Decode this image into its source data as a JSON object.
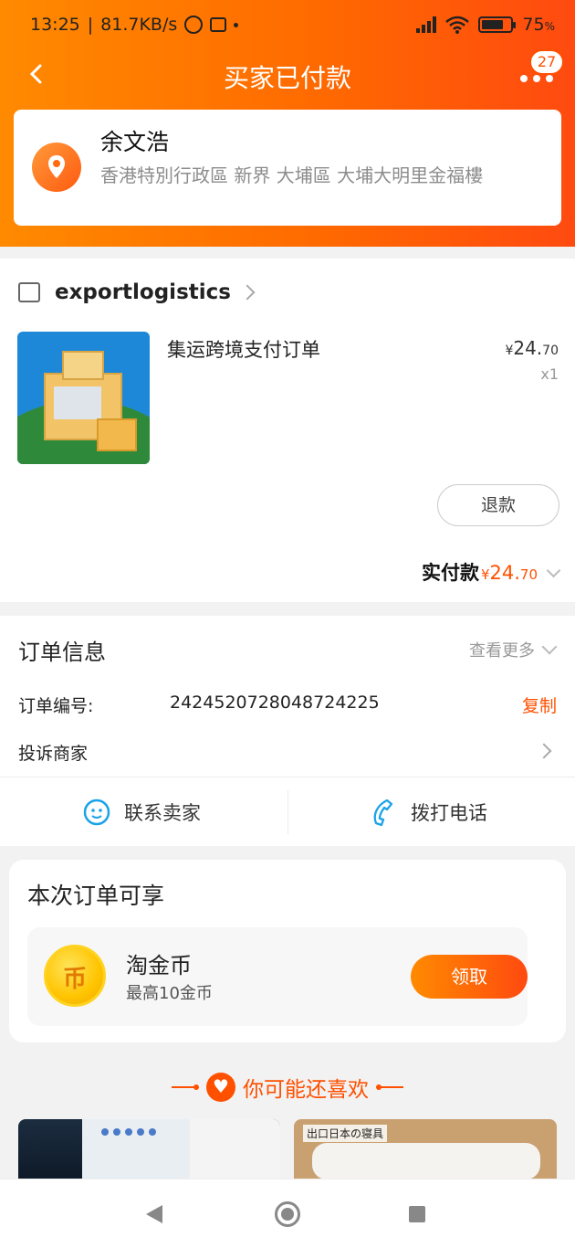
{
  "status_bar": {
    "time": "13:25",
    "speed": "81.7KB/s",
    "battery": "75",
    "battery_level": 0.75
  },
  "nav": {
    "title": "买家已付款",
    "badge_count": "27"
  },
  "address": {
    "name": "余文浩",
    "detail": "香港特別行政區 新界 大埔區 大埔大明里金福樓"
  },
  "shop": {
    "name": "exportlogistics",
    "item": {
      "title": "集运跨境支付订单",
      "price_symbol": "¥",
      "price_int": "24.",
      "price_dec": "70",
      "qty": "x1"
    },
    "refund_label": "退款",
    "paid_label": "实付款",
    "paid_symbol": "¥",
    "paid_int": "24.",
    "paid_dec": "70"
  },
  "order": {
    "title": "订单信息",
    "see_more": "查看更多",
    "order_no_label": "订单编号:",
    "order_no": "2424520728048724225",
    "copy_label": "复制",
    "complain_label": "投诉商家",
    "contact_seller": "联系卖家",
    "call_phone": "拨打电话"
  },
  "benefit": {
    "title": "本次订单可享",
    "coin_name": "淘金币",
    "coin_sub": "最高10金币",
    "claim_label": "领取"
  },
  "recommend": {
    "title": "你可能还喜欢",
    "product_2_caption": "出口日本の寝具"
  },
  "colors": {
    "accent": "#ff5000",
    "header_start": "#ff8a00",
    "header_end": "#ff4a10"
  }
}
